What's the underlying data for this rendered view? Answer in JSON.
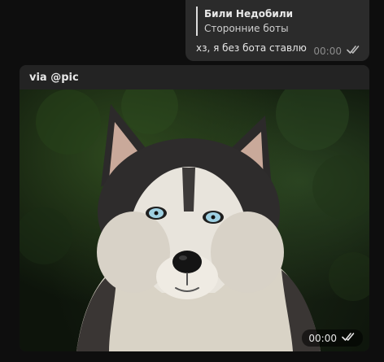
{
  "outgoing": {
    "reply": {
      "author": "Били Недобили",
      "text": "Сторонние боты"
    },
    "text": "хз, я без бота ставлю",
    "time": "00:00",
    "status_icon": "double-check-icon"
  },
  "incoming": {
    "via": "via @pic",
    "time": "00:00",
    "status_icon": "double-check-icon",
    "image_subject": "husky-dog-photo"
  },
  "colors": {
    "background": "#0e0e0e",
    "bubble_out": "#2b2b2b",
    "bubble_in": "#232323",
    "meta_text": "#8c8c8c",
    "reply_bar": "#dddddd"
  }
}
